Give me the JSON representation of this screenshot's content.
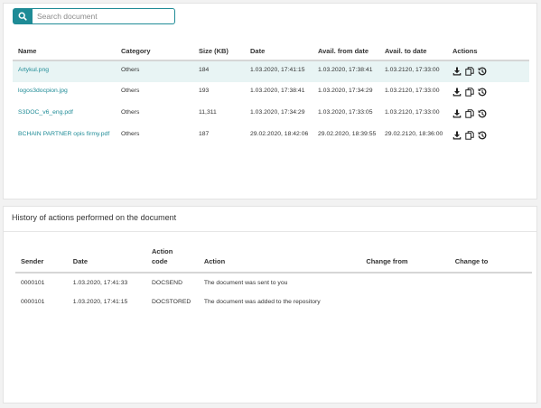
{
  "search": {
    "placeholder": "Search document",
    "icon": "search-icon"
  },
  "documents": {
    "columns": [
      "Name",
      "Category",
      "Size (KB)",
      "Date",
      "Avail. from date",
      "Avail. to date",
      "Actions"
    ],
    "rows": [
      {
        "name": "Artykul.png",
        "category": "Others",
        "size": "184",
        "date": "1.03.2020, 17:41:15",
        "from": "1.03.2020, 17:38:41",
        "to": "1.03.2120, 17:33:00"
      },
      {
        "name": "logos3docpion.jpg",
        "category": "Others",
        "size": "193",
        "date": "1.03.2020, 17:38:41",
        "from": "1.03.2020, 17:34:29",
        "to": "1.03.2120, 17:33:00"
      },
      {
        "name": "S3DOC_v6_eng.pdf",
        "category": "Others",
        "size": "11,311",
        "date": "1.03.2020, 17:34:29",
        "from": "1.03.2020, 17:33:05",
        "to": "1.03.2120, 17:33:00"
      },
      {
        "name": "BCHAIN PARTNER opis firmy.pdf",
        "category": "Others",
        "size": "187",
        "date": "29.02.2020, 18:42:06",
        "from": "29.02.2020, 18:39:55",
        "to": "29.02.2120, 18:36:00"
      }
    ],
    "action_icons": [
      "download-icon",
      "copy-icon",
      "history-icon"
    ]
  },
  "history": {
    "title": "History of actions performed on the document",
    "columns": {
      "sender": "Sender",
      "date": "Date",
      "action_code": "Action code",
      "action": "Action",
      "change_from": "Change from",
      "change_to": "Change to"
    },
    "rows": [
      {
        "sender": "0000101",
        "date": "1.03.2020, 17:41:33",
        "code": "DOCSEND",
        "action": "The document was sent to you",
        "change_from": "",
        "change_to": ""
      },
      {
        "sender": "0000101",
        "date": "1.03.2020, 17:41:15",
        "code": "DOCSTORED",
        "action": "The document was added to the repository",
        "change_from": "",
        "change_to": ""
      }
    ]
  },
  "colors": {
    "accent": "#1e8b96",
    "selected_row": "#e8f4f4"
  }
}
